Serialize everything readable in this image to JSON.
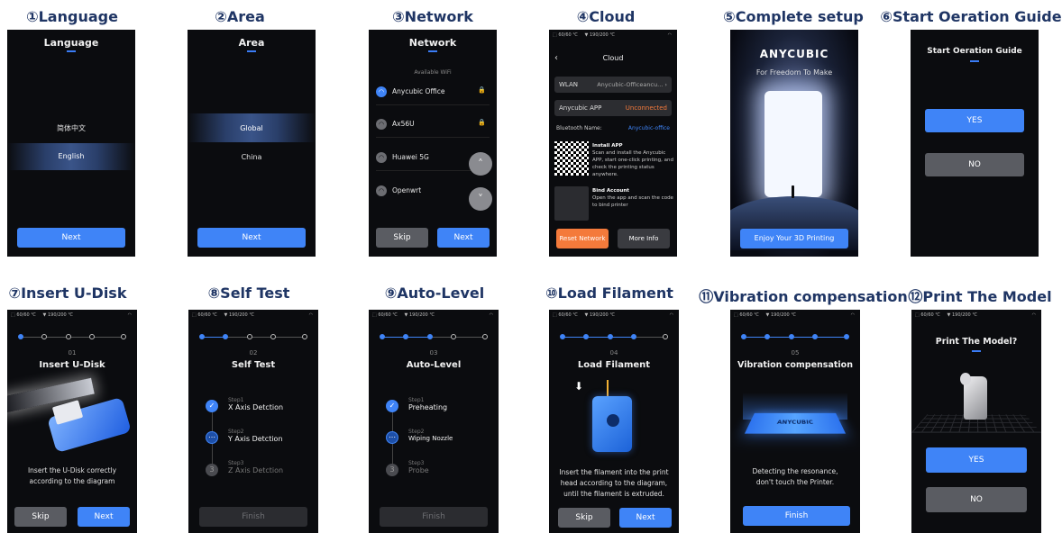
{
  "colors": {
    "title": "#1f3564",
    "accent": "#3f84f7",
    "orange": "#f47a3b",
    "screen_bg": "#0b0c0f"
  },
  "titles": [
    "①Language",
    "②Area",
    "③Network",
    "④Cloud",
    "⑤Complete setup",
    "⑥Start Oeration Guide",
    "⑦Insert U-Disk",
    "⑧Self Test",
    "⑨Auto-Level",
    "⑩Load Filament",
    "⑪Vibration compensation",
    "⑫Print The Model"
  ],
  "status": {
    "nozzle": "⬚ 60/60 ℃",
    "bed": "▼ 190/200 ℃",
    "wifi": "◠"
  },
  "language": {
    "header": "Language",
    "options": [
      "简体中文",
      "English"
    ],
    "next": "Next"
  },
  "area": {
    "header": "Area",
    "options": [
      "Global",
      "China"
    ],
    "next": "Next"
  },
  "network": {
    "header": "Network",
    "available": "Available WiFi",
    "networks": [
      {
        "name": "Anycubic Office",
        "lock": "🔒"
      },
      {
        "name": "Ax56U",
        "lock": "🔒"
      },
      {
        "name": "Huawei 5G",
        "lock": ""
      },
      {
        "name": "Openwrt",
        "lock": ""
      }
    ],
    "skip": "Skip",
    "next": "Next",
    "up": "˄",
    "down": "˅"
  },
  "cloud": {
    "header": "Cloud",
    "back": "‹",
    "wlan_label": "WLAN",
    "wlan_value": "Anycubic-Officeancu... ›",
    "app_label": "Anycubic APP",
    "app_value": "Unconnected",
    "bt_label": "Bluetooth Name:",
    "bt_value": "Anycubic-office",
    "install_title": "Install APP",
    "install_text": "Scan and install the Anycubic APP, start one-click printing, and check the printing status anywhere.",
    "bind_title": "Bind Account",
    "bind_text": "Open the app and scan the code to bind printer",
    "reset": "Reset Network",
    "more": "More Info"
  },
  "complete": {
    "brand": "ANYCUBIC",
    "slogan": "For Freedom To Make",
    "button": "Enjoy Your 3D Printing"
  },
  "guide": {
    "header": "Start Oeration Guide",
    "yes": "YES",
    "no": "NO"
  },
  "udisk": {
    "num": "01",
    "header": "Insert U-Disk",
    "msg1": "Insert the U-Disk correctly",
    "msg2": "according to the diagram",
    "skip": "Skip",
    "next": "Next"
  },
  "selftest": {
    "num": "02",
    "header": "Self Test",
    "steps": [
      {
        "label": "Step1",
        "text": "X Axis Detction",
        "icon": "✓"
      },
      {
        "label": "Step2",
        "text": "Y Axis Detction",
        "icon": "⋯"
      },
      {
        "label": "Step3",
        "text": "Z Axis Detction",
        "icon": "3"
      }
    ],
    "finish": "Finish"
  },
  "autolevel": {
    "num": "03",
    "header": "Auto-Level",
    "steps": [
      {
        "label": "Step1",
        "text": "Preheating",
        "icon": "✓"
      },
      {
        "label": "Step2",
        "text": "Wiping Nozzle",
        "icon": "⋯"
      },
      {
        "label": "Step3",
        "text": "Probe",
        "icon": "3"
      }
    ],
    "finish": "Finish"
  },
  "filament": {
    "num": "04",
    "header": "Load Filament",
    "msg1": "Insert the filament into the print",
    "msg2": "head according to the diagram,",
    "msg3": "until the filament is extruded.",
    "skip": "Skip",
    "next": "Next"
  },
  "vibration": {
    "num": "05",
    "header": "Vibration compensation",
    "plate_brand": "ANYCUBIC",
    "msg1": "Detecting the resonance,",
    "msg2": "don't touch the Printer.",
    "finish": "Finish"
  },
  "printmodel": {
    "header": "Print The Model?",
    "yes": "YES",
    "no": "NO"
  }
}
